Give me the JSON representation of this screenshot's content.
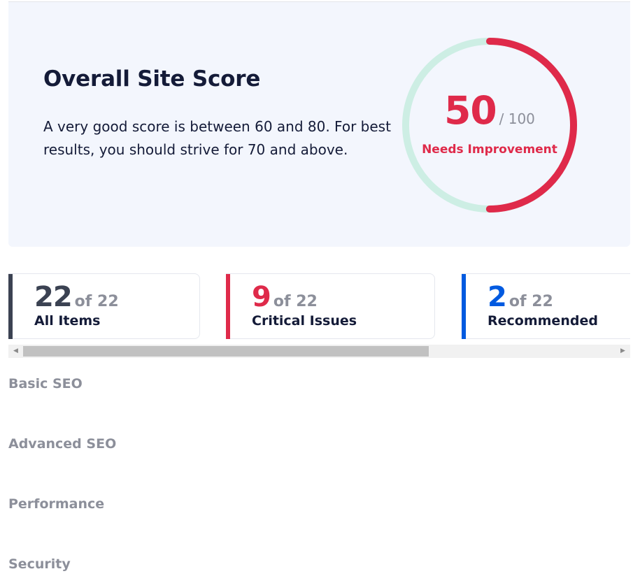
{
  "score_panel": {
    "title": "Overall Site Score",
    "description": "A very good score is between 60 and 80. For best results, you should strive for 70 and above.",
    "score": "50",
    "max": "/ 100",
    "status": "Needs Improvement",
    "score_fraction": 0.5,
    "colors": {
      "score": "#df2a4a",
      "track": "#cdeee4"
    }
  },
  "stats": [
    {
      "count": "22",
      "of_total": "of 22",
      "label": "All Items",
      "color": "#3b4252"
    },
    {
      "count": "9",
      "of_total": "of 22",
      "label": "Critical Issues",
      "color": "#df2a4a"
    },
    {
      "count": "2",
      "of_total": "of 22",
      "label": "Recommended",
      "color": "#005ae0"
    }
  ],
  "sections": [
    {
      "label": "Basic SEO"
    },
    {
      "label": "Advanced SEO"
    },
    {
      "label": "Performance"
    },
    {
      "label": "Security"
    }
  ]
}
